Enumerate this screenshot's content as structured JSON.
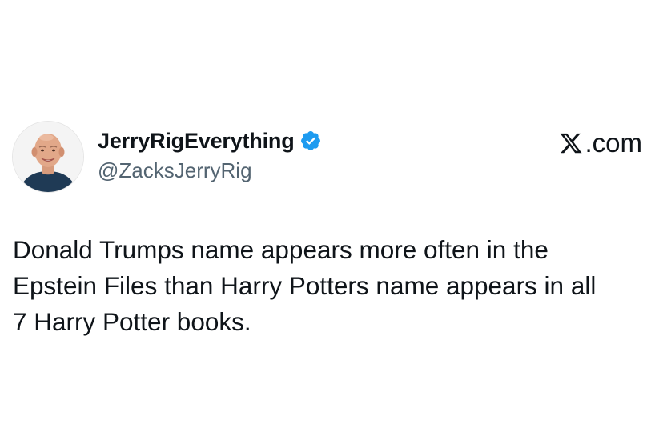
{
  "tweet": {
    "author": {
      "display_name": "JerryRigEverything",
      "handle": "@ZacksJerryRig",
      "verified": true,
      "verified_color": "#1d9bf0",
      "avatar_icon": "profile-photo"
    },
    "brand": {
      "label": ".com",
      "icon": "x-logo-icon"
    },
    "text": "Donald Trumps name appears more often in the\nEpstein Files than Harry Potters name appears in all\n7 Harry Potter books."
  }
}
